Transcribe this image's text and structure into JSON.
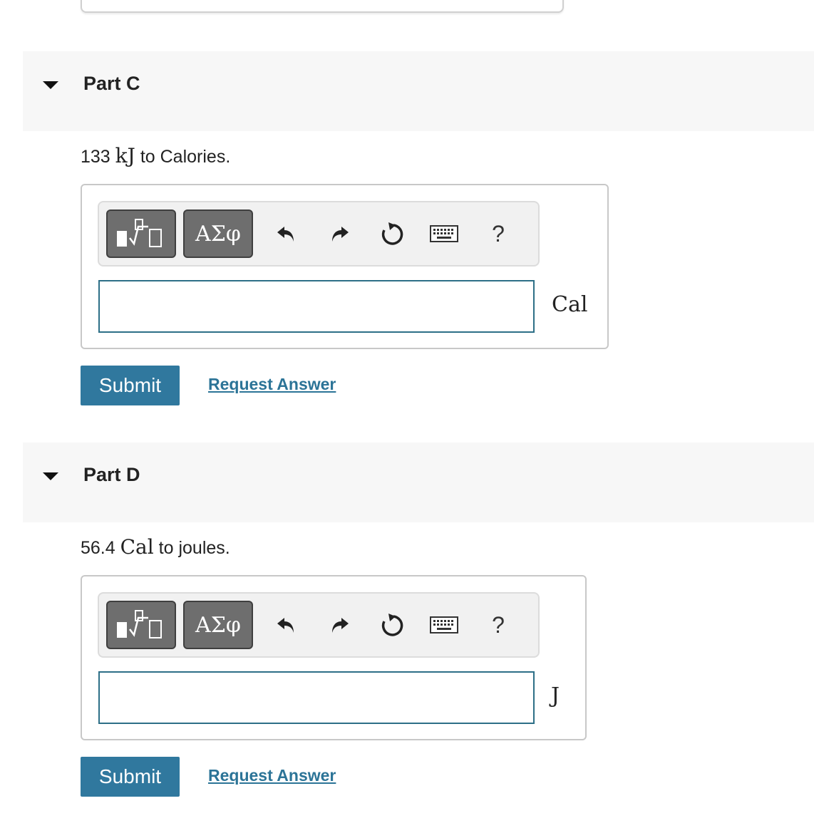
{
  "parts": [
    {
      "title": "Part C",
      "question": {
        "value": "133",
        "unit": "kJ",
        "rest": "to Calories."
      },
      "toolbar": {
        "greek_label": "ΑΣφ",
        "help_label": "?"
      },
      "answer": {
        "value": "",
        "unit": "Cal"
      },
      "submit_label": "Submit",
      "request_label": "Request Answer"
    },
    {
      "title": "Part D",
      "question": {
        "value": "56.4",
        "unit": "Cal",
        "rest": "to joules."
      },
      "toolbar": {
        "greek_label": "ΑΣφ",
        "help_label": "?"
      },
      "answer": {
        "value": "",
        "unit": "J"
      },
      "submit_label": "Submit",
      "request_label": "Request Answer"
    }
  ],
  "colors": {
    "accent": "#30789e",
    "link": "#2c7497",
    "header_bg": "#f7f7f7",
    "input_border": "#2d6f87"
  }
}
